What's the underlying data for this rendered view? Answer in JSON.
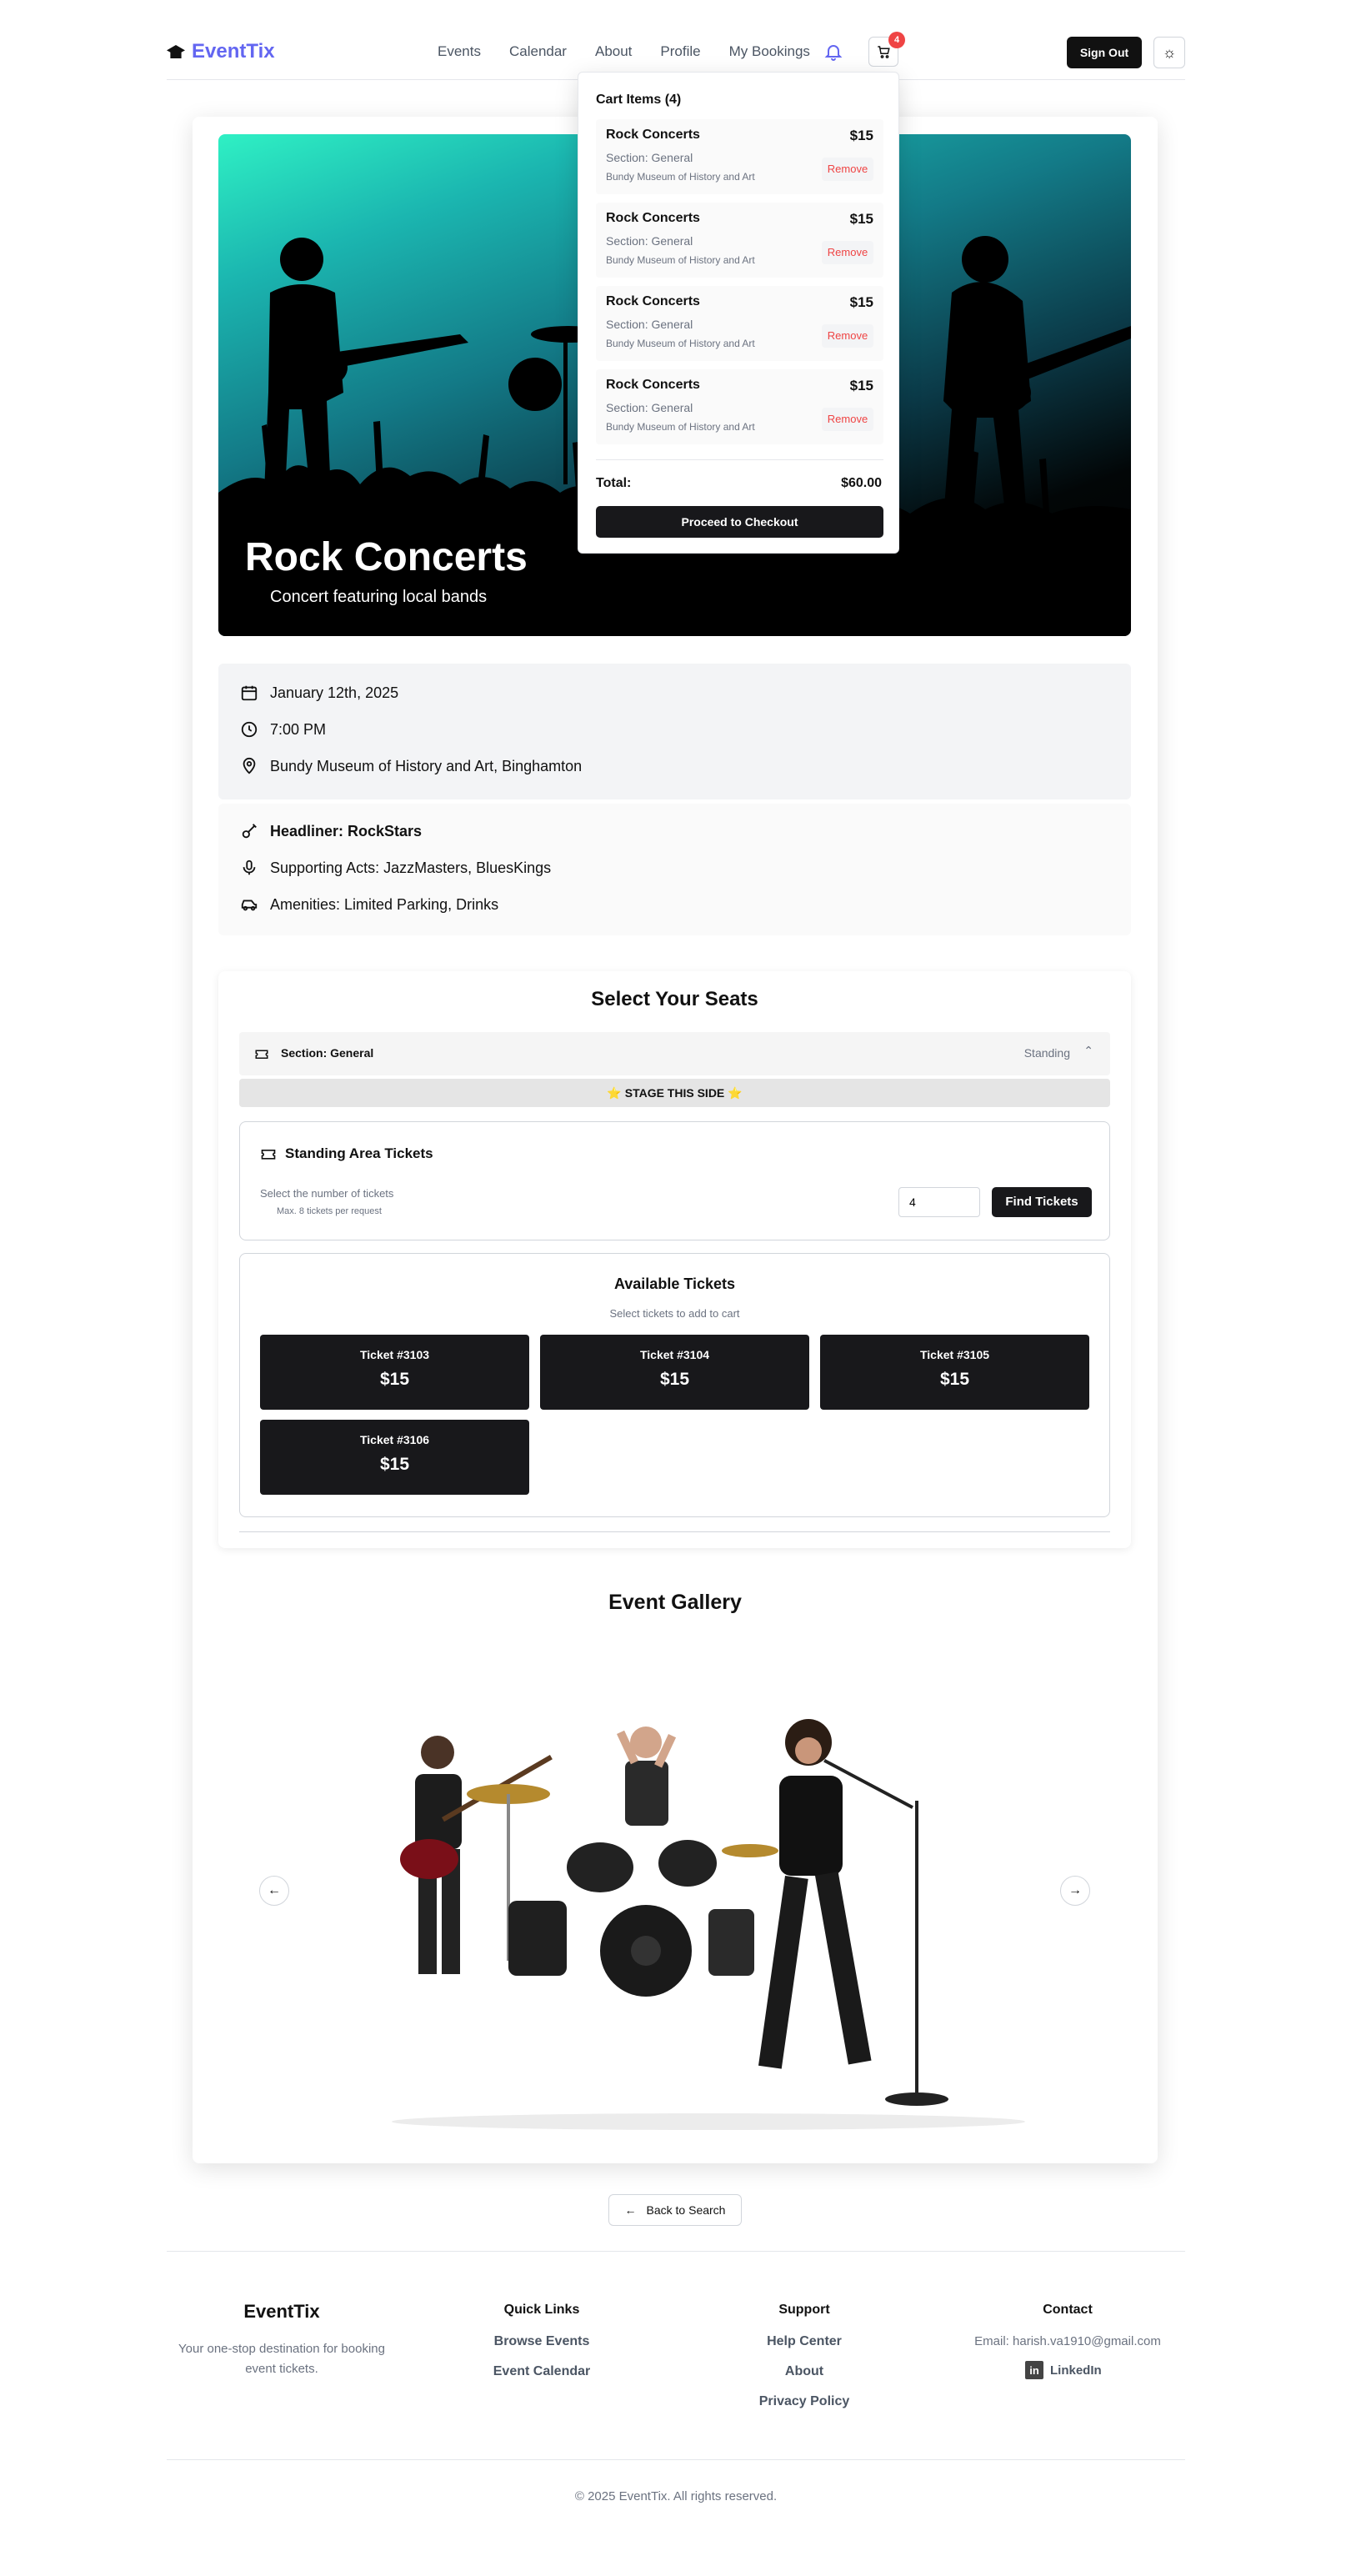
{
  "brand": {
    "name": "EventTix",
    "accent": "#6366f1"
  },
  "nav": [
    "Events",
    "Calendar",
    "About",
    "Profile",
    "My Bookings"
  ],
  "header": {
    "cart_count": "4",
    "sign_out": "Sign Out"
  },
  "cart": {
    "title": "Cart Items (4)",
    "items": [
      {
        "name": "Rock Concerts",
        "price": "$15",
        "section": "Section: General",
        "venue": "Bundy Museum of History and Art",
        "remove": "Remove"
      },
      {
        "name": "Rock Concerts",
        "price": "$15",
        "section": "Section: General",
        "venue": "Bundy Museum of History and Art",
        "remove": "Remove"
      },
      {
        "name": "Rock Concerts",
        "price": "$15",
        "section": "Section: General",
        "venue": "Bundy Museum of History and Art",
        "remove": "Remove"
      },
      {
        "name": "Rock Concerts",
        "price": "$15",
        "section": "Section: General",
        "venue": "Bundy Museum of History and Art",
        "remove": "Remove"
      }
    ],
    "total_label": "Total:",
    "total": "$60.00",
    "checkout": "Proceed to Checkout"
  },
  "event": {
    "title": "Rock Concerts",
    "subtitle": "Concert featuring local bands",
    "date": "January 12th, 2025",
    "time": "7:00 PM",
    "location": "Bundy Museum of History and Art, Binghamton",
    "headliner": "Headliner: RockStars",
    "supporting": "Supporting Acts: JazzMasters, BluesKings",
    "amenities": "Amenities: Limited Parking, Drinks"
  },
  "seats": {
    "title": "Select Your Seats",
    "section_label": "Section: General",
    "section_type": "Standing",
    "stage": "⭐ STAGE THIS SIDE ⭐",
    "standing_title": "Standing Area Tickets",
    "select_label": "Select the number of tickets",
    "max_note": "Max. 8 tickets per request",
    "quantity": "4",
    "find_button": "Find Tickets",
    "available_title": "Available Tickets",
    "available_sub": "Select tickets to add to cart",
    "tickets": [
      {
        "name": "Ticket #3103",
        "price": "$15"
      },
      {
        "name": "Ticket #3104",
        "price": "$15"
      },
      {
        "name": "Ticket #3105",
        "price": "$15"
      },
      {
        "name": "Ticket #3106",
        "price": "$15"
      }
    ]
  },
  "gallery": {
    "title": "Event Gallery"
  },
  "back_button": "Back to Search",
  "footer": {
    "brand": "EventTix",
    "tagline_1": "Your one-stop destination for booking",
    "tagline_2": "event tickets.",
    "quick_links_title": "Quick Links",
    "quick_links": [
      "Browse Events",
      "Event Calendar"
    ],
    "support_title": "Support",
    "support_links": [
      "Help Center",
      "About",
      "Privacy Policy"
    ],
    "contact_title": "Contact",
    "email": "Email: harish.va1910@gmail.com",
    "linkedin": "LinkedIn",
    "copyright": "© 2025 EventTix. All rights reserved."
  }
}
